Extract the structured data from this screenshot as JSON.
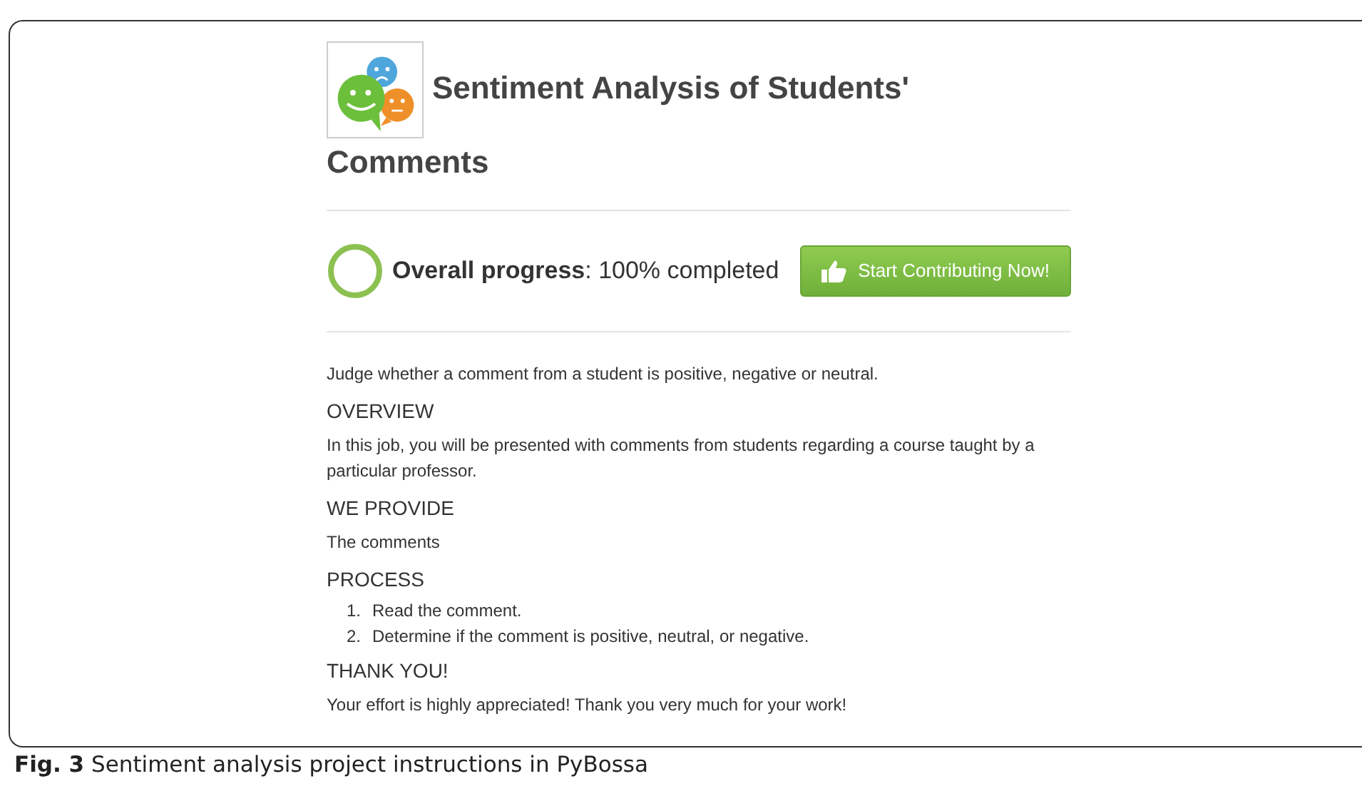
{
  "project": {
    "title_lines": [
      "Sentiment Analysis of Students'",
      "Comments"
    ],
    "progress": {
      "text": "**Overall progress**: 100% completed"
    },
    "button": "Start Contributing Now!"
  },
  "instructions": [
    {
      "kind": "paragraph",
      "text": "Judge whether a comment from a student is positive, negative or neutral."
    },
    {
      "kind": "heading",
      "text": "OVERVIEW"
    },
    {
      "kind": "paragraph",
      "text": "In this job, you will be presented with comments from students regarding a course taught by a particular professor."
    },
    {
      "kind": "heading",
      "text": "WE PROVIDE"
    },
    {
      "kind": "paragraph",
      "text": "The comments"
    },
    {
      "kind": "heading",
      "text": "PROCESS"
    },
    {
      "kind": "list",
      "items": [
        {
          "number": "1.",
          "text": "Read the comment."
        },
        {
          "number": "2.",
          "text": "Determine if the comment is positive, neutral, or negative."
        }
      ]
    },
    {
      "kind": "heading",
      "text": "THANK YOU!"
    },
    {
      "kind": "paragraph",
      "text": "Your effort is highly appreciated! Thank you very much for your work!"
    }
  ],
  "caption": "**Fig. 3** Sentiment analysis project instructions in PyBossa"
}
